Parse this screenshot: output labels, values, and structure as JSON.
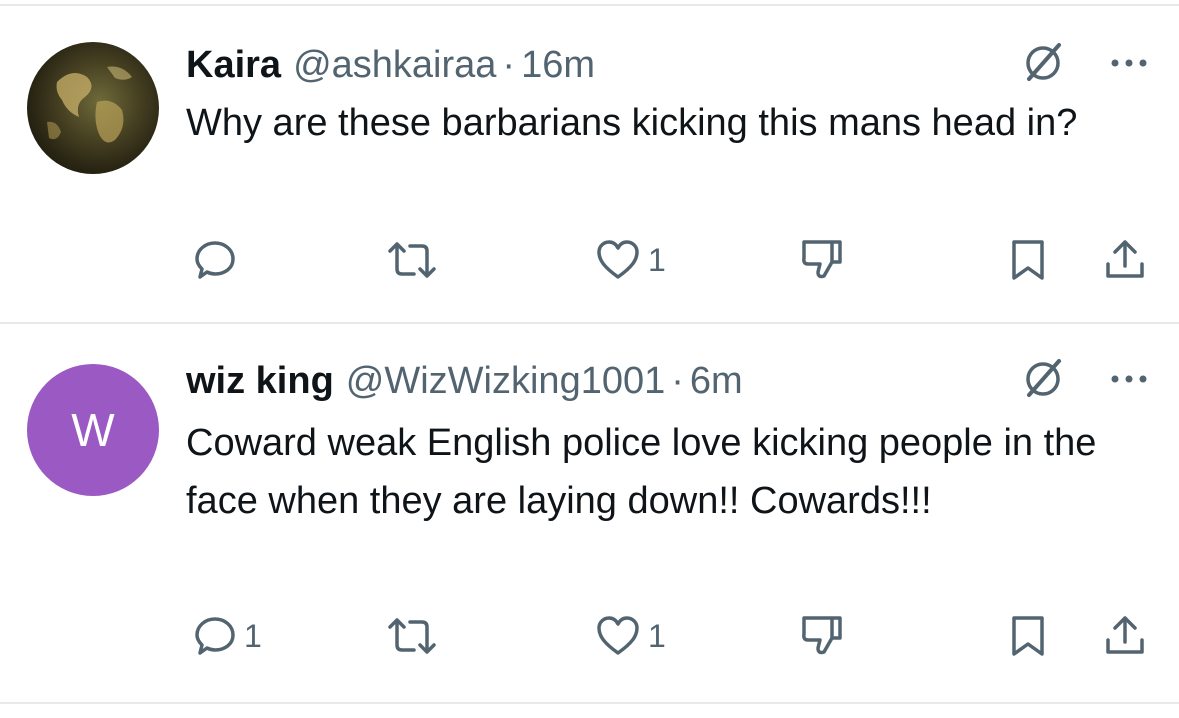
{
  "tweets": [
    {
      "avatar_letter": "",
      "name": "Kaira",
      "handle": "@ashkairaa",
      "separator": "·",
      "time": "16m",
      "text": "Why are these barbarians kicking this mans head in?",
      "replies": "",
      "likes": "1"
    },
    {
      "avatar_letter": "W",
      "avatar_color": "#9b59c4",
      "name": "wiz king",
      "handle": "@WizWizking1001",
      "separator": "·",
      "time": "6m",
      "text": "Coward weak English police love kicking people in the face when they are laying down!! Cowards!!!",
      "replies": "1",
      "likes": "1"
    }
  ],
  "icons": {
    "reply": "reply-icon",
    "retweet": "retweet-icon",
    "like": "heart-icon",
    "dislike": "thumbs-down-icon",
    "bookmark": "bookmark-icon",
    "share": "share-icon",
    "grok": "grok-icon",
    "more": "more-icon"
  },
  "colors": {
    "text": "#0f1419",
    "secondary": "#536471",
    "divider": "#e7e9ea"
  }
}
